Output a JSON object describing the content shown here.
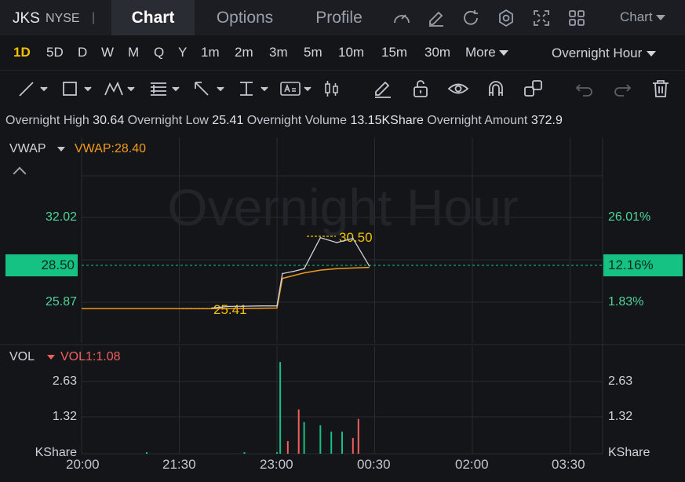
{
  "header": {
    "ticker": "JKS",
    "exchange": "NYSE",
    "separator": "|",
    "tabs": [
      {
        "label": "Chart"
      },
      {
        "label": "Options"
      },
      {
        "label": "Profile"
      }
    ],
    "chart_menu": "Chart",
    "icons": [
      "speedometer-icon",
      "edit-icon",
      "refresh-icon",
      "settings-icon",
      "fullscreen-icon",
      "grid-icon"
    ]
  },
  "timeframes": {
    "items": [
      "1D",
      "5D",
      "D",
      "W",
      "M",
      "Q",
      "Y",
      "1m",
      "2m",
      "3m",
      "5m",
      "10m",
      "15m",
      "30m"
    ],
    "selected": "1D",
    "more": "More",
    "session": "Overnight Hour"
  },
  "draw_tools": [
    "trend-line-icon",
    "rectangle-icon",
    "pattern-icon",
    "fib-icon",
    "arrow-icon",
    "vertical-line-icon",
    "text-icon",
    "candle-icon",
    "pen-icon",
    "unlock-icon",
    "eye-icon",
    "magnet-icon",
    "clone-icon",
    "undo-icon",
    "redo-icon",
    "trash-icon"
  ],
  "info": {
    "high_label": "Overnight High",
    "high": "30.64",
    "low_label": "Overnight Low",
    "low": "25.41",
    "volume_label": "Overnight Volume",
    "volume": "13.15KShare",
    "amount_label": "Overnight Amount",
    "amount": "372.9"
  },
  "price_panel": {
    "indicator": "VWAP",
    "indicator_value": "VWAP:28.40",
    "watermark": "Overnight Hour",
    "left_ticks": [
      "32.02",
      "28.50",
      "25.87"
    ],
    "right_ticks": [
      "26.01%",
      "12.16%",
      "1.83%"
    ],
    "current_price": "28.50",
    "current_pct": "12.16%",
    "high_marker": "30.50",
    "low_marker": "25.41"
  },
  "volume_panel": {
    "indicator": "VOL",
    "indicator_value": "VOL1:1.08",
    "left_ticks": [
      "2.63",
      "1.32",
      "KShare"
    ],
    "right_ticks": [
      "2.63",
      "1.32",
      "KShare"
    ]
  },
  "time_axis": [
    "20:00",
    "21:30",
    "23:00",
    "00:30",
    "02:00",
    "03:30"
  ],
  "colors": {
    "up": "#16c184",
    "down": "#f0605d",
    "vwap": "#f29a1b",
    "marker": "#f2c200",
    "price_line": "#cfd2d8"
  },
  "chart_data": {
    "type": "line",
    "x": [
      "22:00",
      "22:15",
      "22:30",
      "22:45",
      "23:00",
      "23:05",
      "23:15",
      "23:25",
      "23:40",
      "23:55",
      "00:10",
      "00:25"
    ],
    "series": [
      {
        "values": [
          25.45,
          25.56,
          25.58,
          25.6,
          25.6,
          27.95,
          28.1,
          28.3,
          30.55,
          30.2,
          30.5,
          28.5
        ]
      },
      {
        "name": "VWAP",
        "values": [
          25.41,
          25.42,
          25.43,
          25.44,
          25.45,
          27.6,
          27.8,
          28.0,
          28.2,
          28.3,
          28.35,
          28.4
        ]
      }
    ],
    "ylim": [
      24.5,
      33.5
    ],
    "volume": {
      "x": [
        "21:00",
        "22:30",
        "23:00",
        "23:03",
        "23:10",
        "23:20",
        "23:25",
        "23:40",
        "23:50",
        "00:00",
        "00:10",
        "00:15"
      ],
      "values": [
        0.05,
        0.05,
        0.05,
        2.9,
        0.4,
        1.4,
        1.0,
        0.9,
        0.7,
        0.7,
        0.5,
        1.1
      ],
      "directions": [
        "up",
        "up",
        "up",
        "up",
        "down",
        "down",
        "up",
        "up",
        "up",
        "up",
        "down",
        "down"
      ],
      "ylim": [
        0,
        3.4
      ]
    }
  }
}
